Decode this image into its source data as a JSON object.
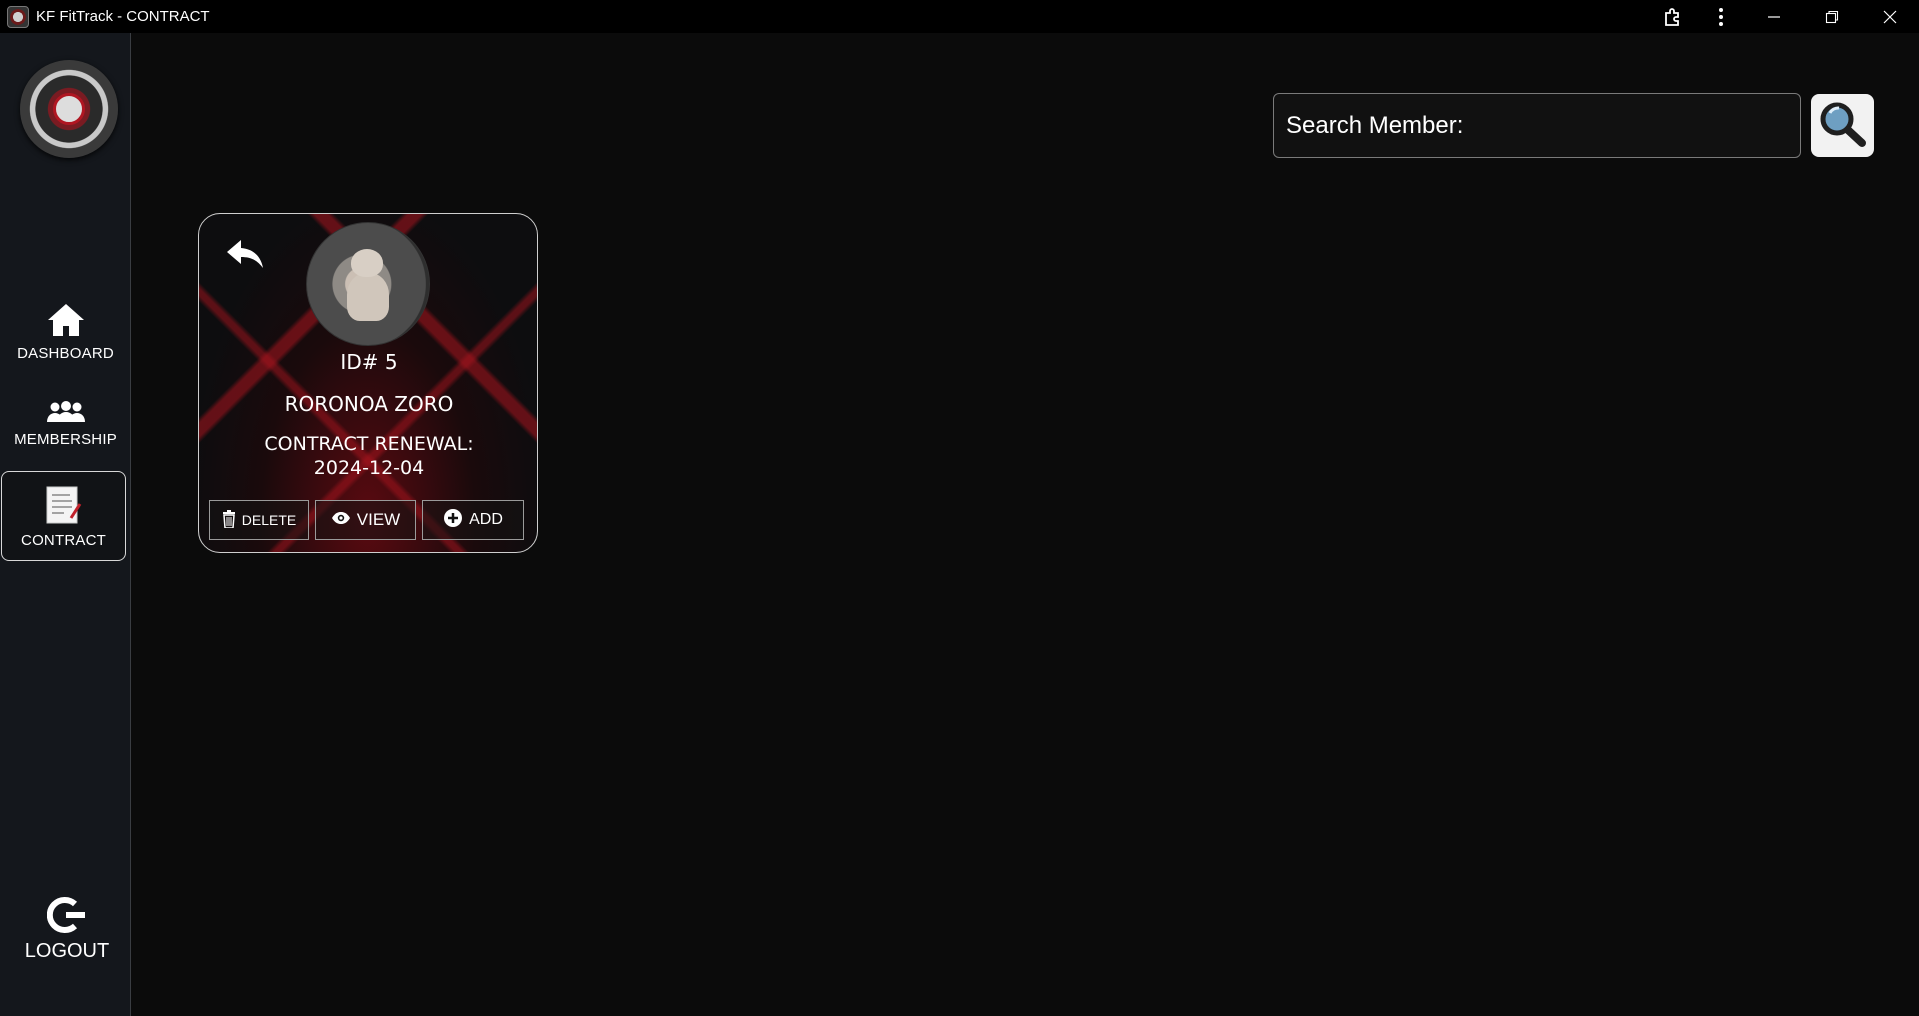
{
  "window": {
    "title": "KF FitTrack - CONTRACT"
  },
  "sidebar": {
    "items": [
      {
        "label": "DASHBOARD",
        "icon": "home-icon"
      },
      {
        "label": "MEMBERSHIP",
        "icon": "users-icon"
      },
      {
        "label": "CONTRACT",
        "icon": "document-icon",
        "active": true
      }
    ],
    "logout_label": "LOGOUT"
  },
  "search": {
    "label": "Search Member:",
    "value": "",
    "placeholder": ""
  },
  "card": {
    "id_text": "ID# 5",
    "name": "RORONOA ZORO",
    "renewal_label": "CONTRACT RENEWAL:",
    "renewal_date": "2024-12-04",
    "delete_label": "DELETE",
    "view_label": "VIEW",
    "add_label": "ADD"
  },
  "colors": {
    "background": "#0b0b0b",
    "sidebar": "#14171c",
    "accent_red": "#b01622"
  }
}
